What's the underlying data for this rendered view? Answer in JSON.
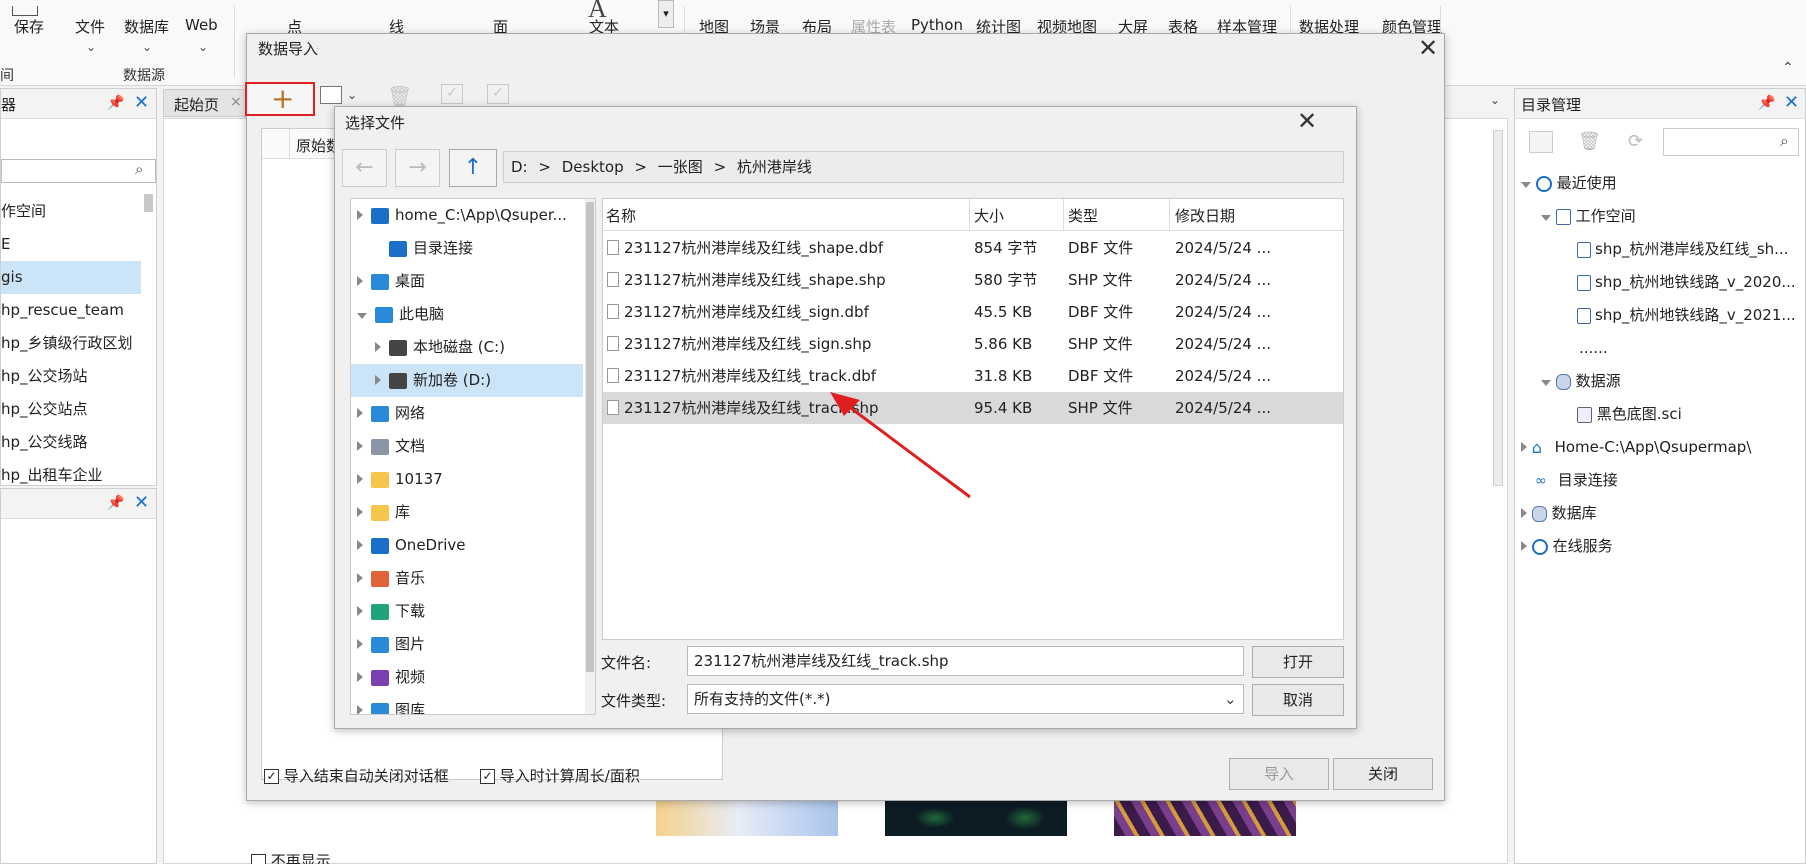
{
  "ribbon": {
    "save": "保存",
    "file": "文件",
    "datasource_btn": "数据库",
    "web": "Web",
    "group_datasource": "数据源",
    "left_cut": "间",
    "point": "点",
    "line": "线",
    "face": "面",
    "text": "文本",
    "text_glyph": "A",
    "map": "地图",
    "scene": "场景",
    "layout": "布局",
    "attr_table": "属性表",
    "python": "Python",
    "stat": "统计图",
    "video_map": "视频地图",
    "big_screen": "大屏",
    "table": "表格",
    "sample_mgmt": "样本管理",
    "data_proc": "数据处理",
    "color_mgmt": "颜色管理"
  },
  "left_panel": {
    "title": "器",
    "items": [
      "作空间",
      "E",
      "gis",
      "hp_rescue_team",
      "hp_乡镇级行政区划",
      "hp_公交场站",
      "hp_公交站点",
      "hp_公交线路",
      "hp_出租车企业"
    ],
    "selected_index": 2
  },
  "tabs": {
    "start": "起始页",
    "close": "×"
  },
  "import_dialog": {
    "title": "数据导入",
    "col_original": "原始数",
    "auto_close_label": "导入结束自动关闭对话框",
    "calc_label": "导入时计算周长/面积",
    "import_btn": "导入",
    "close_btn": "关闭",
    "no_show": "不再显示"
  },
  "file_dialog": {
    "title": "选择文件",
    "path": [
      "D:",
      "Desktop",
      "一张图",
      "杭州港岸线"
    ],
    "path_sep": ">",
    "columns": [
      "名称",
      "大小",
      "类型",
      "修改日期"
    ],
    "files": [
      {
        "name": "231127杭州港岸线及红线_shape.dbf",
        "size": "854 字节",
        "type": "DBF 文件",
        "date": "2024/5/24 ..."
      },
      {
        "name": "231127杭州港岸线及红线_shape.shp",
        "size": "580 字节",
        "type": "SHP 文件",
        "date": "2024/5/24 ..."
      },
      {
        "name": "231127杭州港岸线及红线_sign.dbf",
        "size": "45.5 KB",
        "type": "DBF 文件",
        "date": "2024/5/24 ..."
      },
      {
        "name": "231127杭州港岸线及红线_sign.shp",
        "size": "5.86 KB",
        "type": "SHP 文件",
        "date": "2024/5/24 ..."
      },
      {
        "name": "231127杭州港岸线及红线_track.dbf",
        "size": "31.8 KB",
        "type": "DBF 文件",
        "date": "2024/5/24 ..."
      },
      {
        "name": "231127杭州港岸线及红线_track.shp",
        "size": "95.4 KB",
        "type": "SHP 文件",
        "date": "2024/5/24 ..."
      }
    ],
    "selected_file_index": 5,
    "nav": [
      {
        "label": "home_C:\\App\\Qsuper...",
        "icon": "home-icon"
      },
      {
        "label": "目录连接",
        "icon": "link-icon"
      },
      {
        "label": "桌面",
        "icon": "desktop-icon"
      },
      {
        "label": "此电脑",
        "icon": "computer-icon"
      },
      {
        "label": "本地磁盘 (C:)",
        "icon": "drive-icon"
      },
      {
        "label": "新加卷 (D:)",
        "icon": "drive-icon"
      },
      {
        "label": "网络",
        "icon": "network-icon"
      },
      {
        "label": "文档",
        "icon": "document-icon"
      },
      {
        "label": "10137",
        "icon": "folder-icon"
      },
      {
        "label": "库",
        "icon": "library-icon"
      },
      {
        "label": "OneDrive",
        "icon": "cloud-icon"
      },
      {
        "label": "音乐",
        "icon": "music-icon"
      },
      {
        "label": "下载",
        "icon": "download-icon"
      },
      {
        "label": "图片",
        "icon": "picture-icon"
      },
      {
        "label": "视频",
        "icon": "video-icon"
      },
      {
        "label": "图库",
        "icon": "gallery-icon"
      }
    ],
    "filename_label": "文件名:",
    "filename_value": "231127杭州港岸线及红线_track.shp",
    "filetype_label": "文件类型:",
    "filetype_value": "所有支持的文件(*.*)",
    "open_btn": "打开",
    "cancel_btn": "取消"
  },
  "right_panel": {
    "title": "目录管理",
    "recent": "最近使用",
    "workspace": "工作空间",
    "ws_items": [
      "shp_杭州港岸线及红线_sh...",
      "shp_杭州地铁线路_v_2020...",
      "shp_杭州地铁线路_v_2021..."
    ],
    "ellipsis": "......",
    "datasource": "数据源",
    "ds_item": "黑色底图.sci",
    "home": "Home-C:\\App\\Qsupermap\\",
    "dir_link": "目录连接",
    "database": "数据库",
    "online": "在线服务"
  },
  "colors": {
    "accent": "#1a6fc9",
    "selection": "#cce4f7",
    "file_selected": "#d9d9d9",
    "highlight_box": "#e02020",
    "annotation_arrow": "#e02020"
  }
}
